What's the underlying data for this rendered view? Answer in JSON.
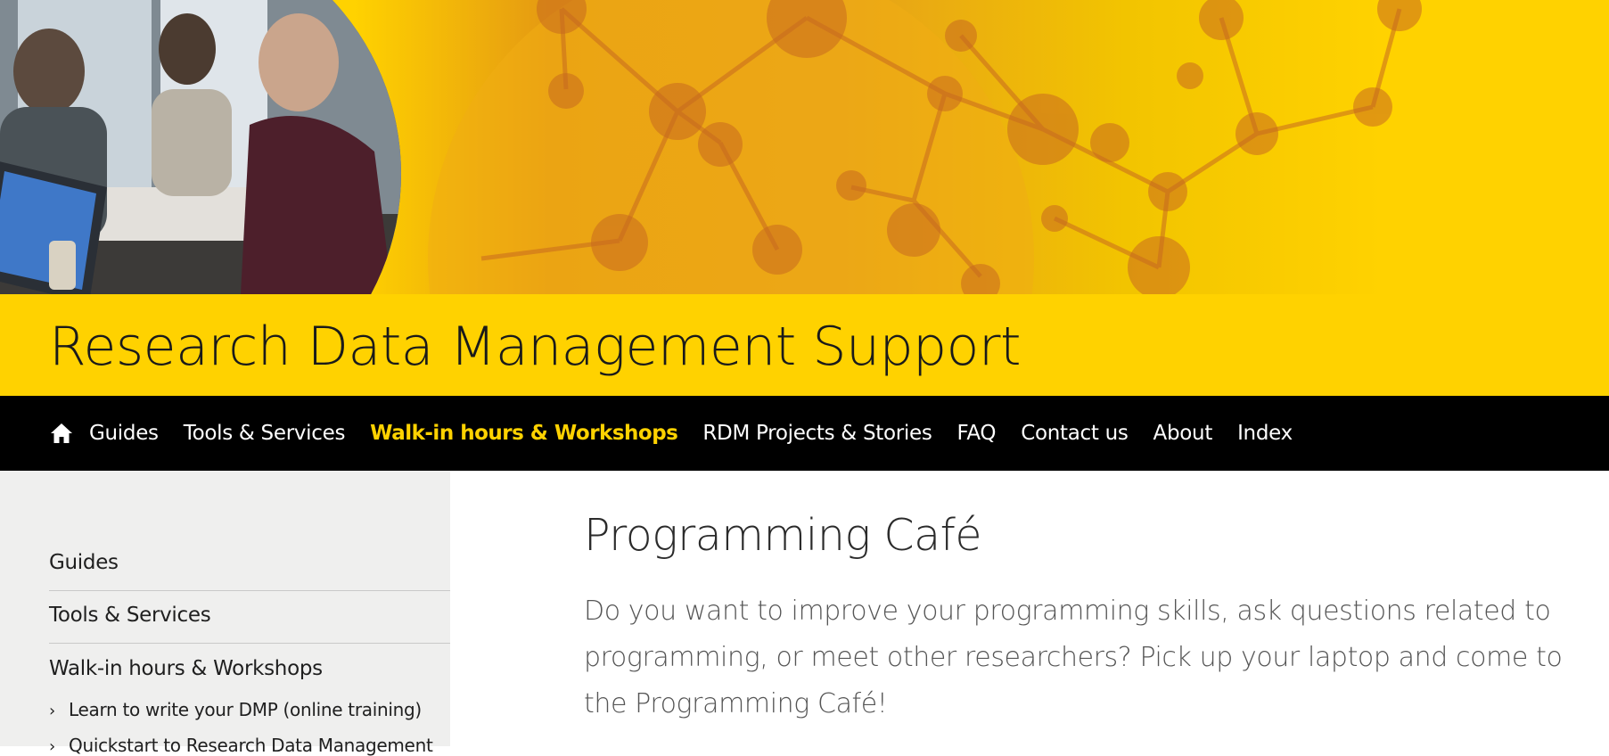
{
  "site": {
    "title": "Research Data Management Support"
  },
  "nav": {
    "home_icon": "home-icon",
    "items": [
      {
        "label": "Guides",
        "active": false
      },
      {
        "label": "Tools & Services",
        "active": false
      },
      {
        "label": "Walk-in hours & Workshops",
        "active": true
      },
      {
        "label": "RDM Projects & Stories",
        "active": false
      },
      {
        "label": "FAQ",
        "active": false
      },
      {
        "label": "Contact us",
        "active": false
      },
      {
        "label": "About",
        "active": false
      },
      {
        "label": "Index",
        "active": false
      }
    ]
  },
  "sidebar": {
    "items": [
      {
        "label": "Guides"
      },
      {
        "label": "Tools & Services"
      },
      {
        "label": "Walk-in hours & Workshops"
      }
    ],
    "subitems": [
      {
        "label": "Learn to write your DMP (online training)"
      },
      {
        "label": "Quickstart to Research Data Management"
      }
    ]
  },
  "main": {
    "title": "Programming Café",
    "intro": "Do you want to improve your programming skills, ask questions related to programming, or meet other researchers? Pick up your laptop and come to the Programming Café!"
  },
  "colors": {
    "brand_yellow": "#ffd200",
    "nav_background": "#000000",
    "nav_active": "#ffd200",
    "sidebar_background": "#efefee"
  }
}
